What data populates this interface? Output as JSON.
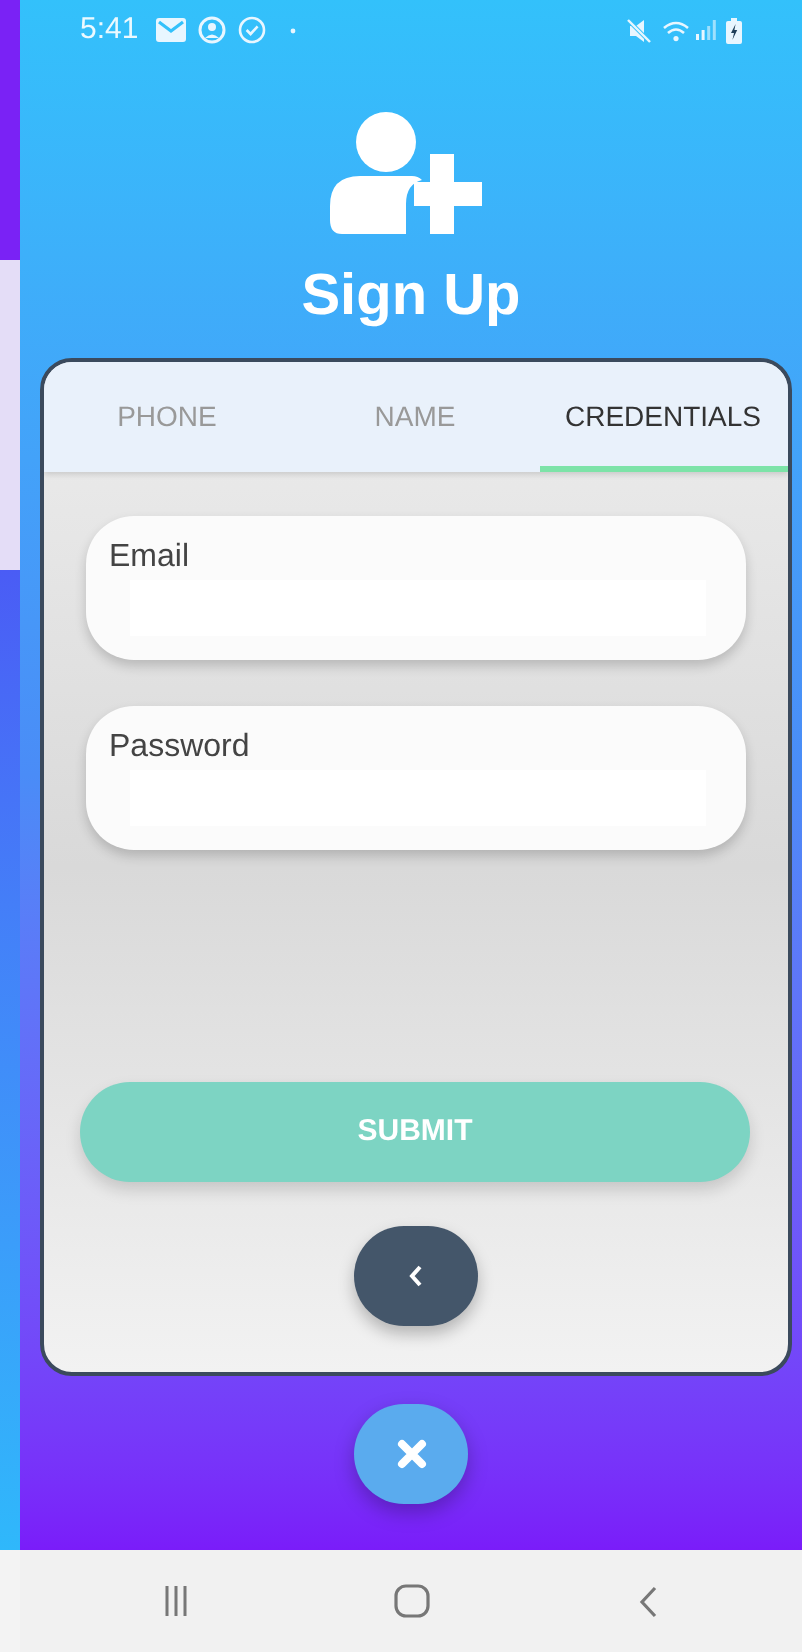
{
  "status_bar": {
    "time": "5:41"
  },
  "header": {
    "title": "Sign Up"
  },
  "tabs": [
    {
      "label": "PHONE",
      "selected": false
    },
    {
      "label": "NAME",
      "selected": false
    },
    {
      "label": "CREDENTIALS",
      "selected": true
    }
  ],
  "fields": [
    {
      "label": "Email"
    },
    {
      "label": "Password"
    }
  ],
  "submit_button": {
    "label": "SUBMIT"
  }
}
